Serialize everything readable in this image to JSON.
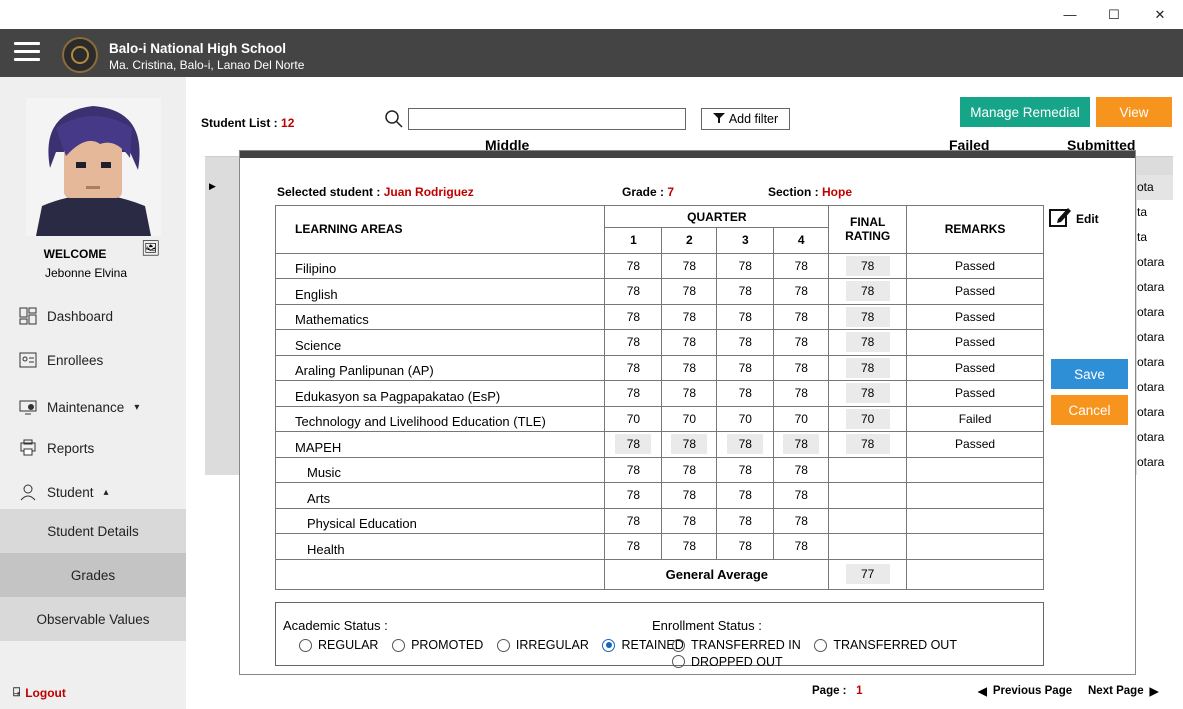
{
  "window": {
    "minimize": "—",
    "maximize": "☐",
    "close": "✕"
  },
  "header": {
    "school_name": "Balo-i National High School",
    "address": "Ma. Cristina, Balo-i, Lanao Del Norte"
  },
  "sidebar": {
    "welcome": "WELCOME",
    "user_name": "Jebonne Elvina",
    "items": [
      {
        "label": "Dashboard",
        "icon": "dashboard-icon"
      },
      {
        "label": "Enrollees",
        "icon": "enrollees-icon"
      },
      {
        "label": "Maintenance",
        "icon": "maintenance-icon",
        "caret": "▾"
      },
      {
        "label": "Reports",
        "icon": "reports-icon"
      },
      {
        "label": "Student",
        "icon": "student-icon",
        "caret": "▴"
      }
    ],
    "subitems": [
      "Student Details",
      "Grades",
      "Observable Values"
    ],
    "logout": "Logout"
  },
  "main": {
    "student_list_label": "Student List :",
    "student_count": "12",
    "add_filter": "Add filter",
    "manage_remedial": "Manage Remedial",
    "view": "View",
    "grid_headers": [
      "Middle",
      "Failed",
      "Submitted"
    ],
    "grid_right_cells": [
      "ota",
      "ta",
      "ta",
      "otara",
      "otara",
      "otara",
      "otara",
      "otara",
      "otara",
      "otara",
      "otara",
      "otara"
    ],
    "page_label": "Page :",
    "page_number": "1",
    "previous_page": "Previous Page",
    "next_page": "Next Page"
  },
  "modal": {
    "selected_student_label": "Selected student :",
    "selected_student": "Juan Rodriguez",
    "grade_label": "Grade :",
    "grade": "7",
    "section_label": "Section :",
    "section": "Hope",
    "edit": "Edit",
    "save": "Save",
    "cancel": "Cancel",
    "table_headers": {
      "learning_areas": "LEARNING AREAS",
      "quarter": "QUARTER",
      "q1": "1",
      "q2": "2",
      "q3": "3",
      "q4": "4",
      "final_rating": "FINAL RATING",
      "remarks": "REMARKS"
    },
    "subjects": [
      {
        "name": "Filipino",
        "q": [
          "78",
          "78",
          "78",
          "78"
        ],
        "final": "78",
        "remarks": "Passed"
      },
      {
        "name": "English",
        "q": [
          "78",
          "78",
          "78",
          "78"
        ],
        "final": "78",
        "remarks": "Passed"
      },
      {
        "name": "Mathematics",
        "q": [
          "78",
          "78",
          "78",
          "78"
        ],
        "final": "78",
        "remarks": "Passed"
      },
      {
        "name": "Science",
        "q": [
          "78",
          "78",
          "78",
          "78"
        ],
        "final": "78",
        "remarks": "Passed"
      },
      {
        "name": "Araling Panlipunan (AP)",
        "q": [
          "78",
          "78",
          "78",
          "78"
        ],
        "final": "78",
        "remarks": "Passed"
      },
      {
        "name": "Edukasyon sa Pagpapakatao (EsP)",
        "q": [
          "78",
          "78",
          "78",
          "78"
        ],
        "final": "78",
        "remarks": "Passed"
      },
      {
        "name": "Technology and Livelihood Education (TLE)",
        "q": [
          "70",
          "70",
          "70",
          "70"
        ],
        "final": "70",
        "remarks": "Failed"
      },
      {
        "name": "MAPEH",
        "q": [
          "78",
          "78",
          "78",
          "78"
        ],
        "final": "78",
        "remarks": "Passed"
      },
      {
        "name": "Music",
        "q": [
          "78",
          "78",
          "78",
          "78"
        ],
        "final": "",
        "remarks": ""
      },
      {
        "name": "Arts",
        "q": [
          "78",
          "78",
          "78",
          "78"
        ],
        "final": "",
        "remarks": ""
      },
      {
        "name": "Physical Education",
        "q": [
          "78",
          "78",
          "78",
          "78"
        ],
        "final": "",
        "remarks": ""
      },
      {
        "name": "Health",
        "q": [
          "78",
          "78",
          "78",
          "78"
        ],
        "final": "",
        "remarks": ""
      }
    ],
    "general_average_label": "General Average",
    "general_average": "77",
    "academic_status_label": "Academic Status :",
    "academic_status_options": [
      "REGULAR",
      "PROMOTED",
      "IRREGULAR",
      "RETAINED"
    ],
    "academic_status_selected": "RETAINED",
    "enrollment_status_label": "Enrollment Status :",
    "enrollment_status_options": [
      "TRANSFERRED IN",
      "TRANSFERRED OUT",
      "DROPPED OUT"
    ]
  }
}
